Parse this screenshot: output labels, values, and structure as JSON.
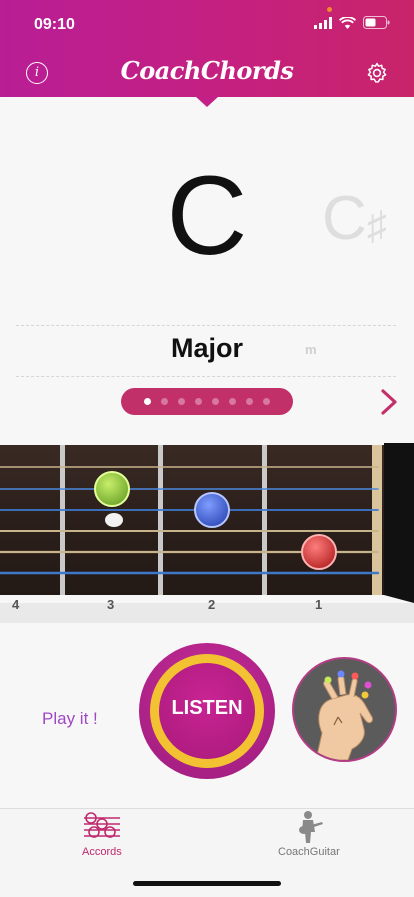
{
  "status": {
    "time": "09:10"
  },
  "header": {
    "title": "CoachChords",
    "info_icon": "info-icon",
    "settings_icon": "gear-icon"
  },
  "chord": {
    "root": "C",
    "next_root": "C",
    "next_accidental": "♯",
    "quality": "Major",
    "next_quality": "m"
  },
  "pager": {
    "count": 8,
    "active_index": 0
  },
  "fretboard": {
    "fret_numbers": [
      "4",
      "3",
      "2",
      "1"
    ],
    "markers": [
      {
        "color": "#8fc83a",
        "name": "green-finger"
      },
      {
        "color": "#4a67d6",
        "name": "blue-finger"
      },
      {
        "color": "#d83a3a",
        "name": "red-finger"
      }
    ]
  },
  "actions": {
    "play_label": "Play it !",
    "listen_label": "LISTEN"
  },
  "colors": {
    "accent": "#c2306a",
    "purple": "#b81e95",
    "ring": "#f3c233",
    "tab_active": "#c02a6e",
    "tab_inactive": "#777777"
  },
  "tabs": [
    {
      "label": "Accords",
      "icon": "chords-icon",
      "active": true
    },
    {
      "label": "CoachGuitar",
      "icon": "guitarist-icon",
      "active": false
    }
  ]
}
